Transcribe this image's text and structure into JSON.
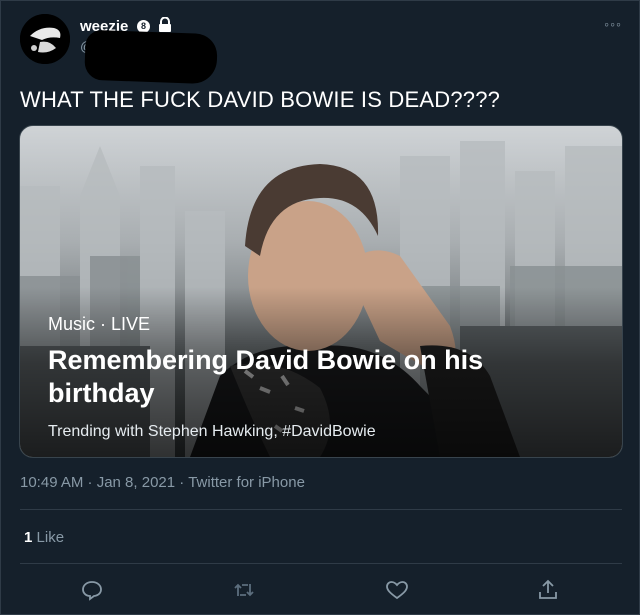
{
  "user": {
    "display_name": "weezie",
    "badge_icon": "private-account-icon",
    "badge_glyph": "8",
    "handle": "@"
  },
  "tweet": {
    "text": "WHAT THE FUCK DAVID BOWIE IS DEAD????"
  },
  "card": {
    "category": "Music · LIVE",
    "title": "Remembering David Bowie on his birthday",
    "subtitle": "Trending with Stephen Hawking, #DavidBowie"
  },
  "meta": {
    "time_date": "10:49 AM · Jan 8, 2021",
    "separator": "·",
    "source": "Twitter for iPhone"
  },
  "stats": {
    "like_count": "1",
    "like_label": "Like"
  },
  "actions": [
    "reply-icon",
    "retweet-icon",
    "like-icon",
    "share-icon"
  ],
  "colors": {
    "background": "#15202b",
    "text_secondary": "#8899a6",
    "divider": "#2f3b47"
  }
}
